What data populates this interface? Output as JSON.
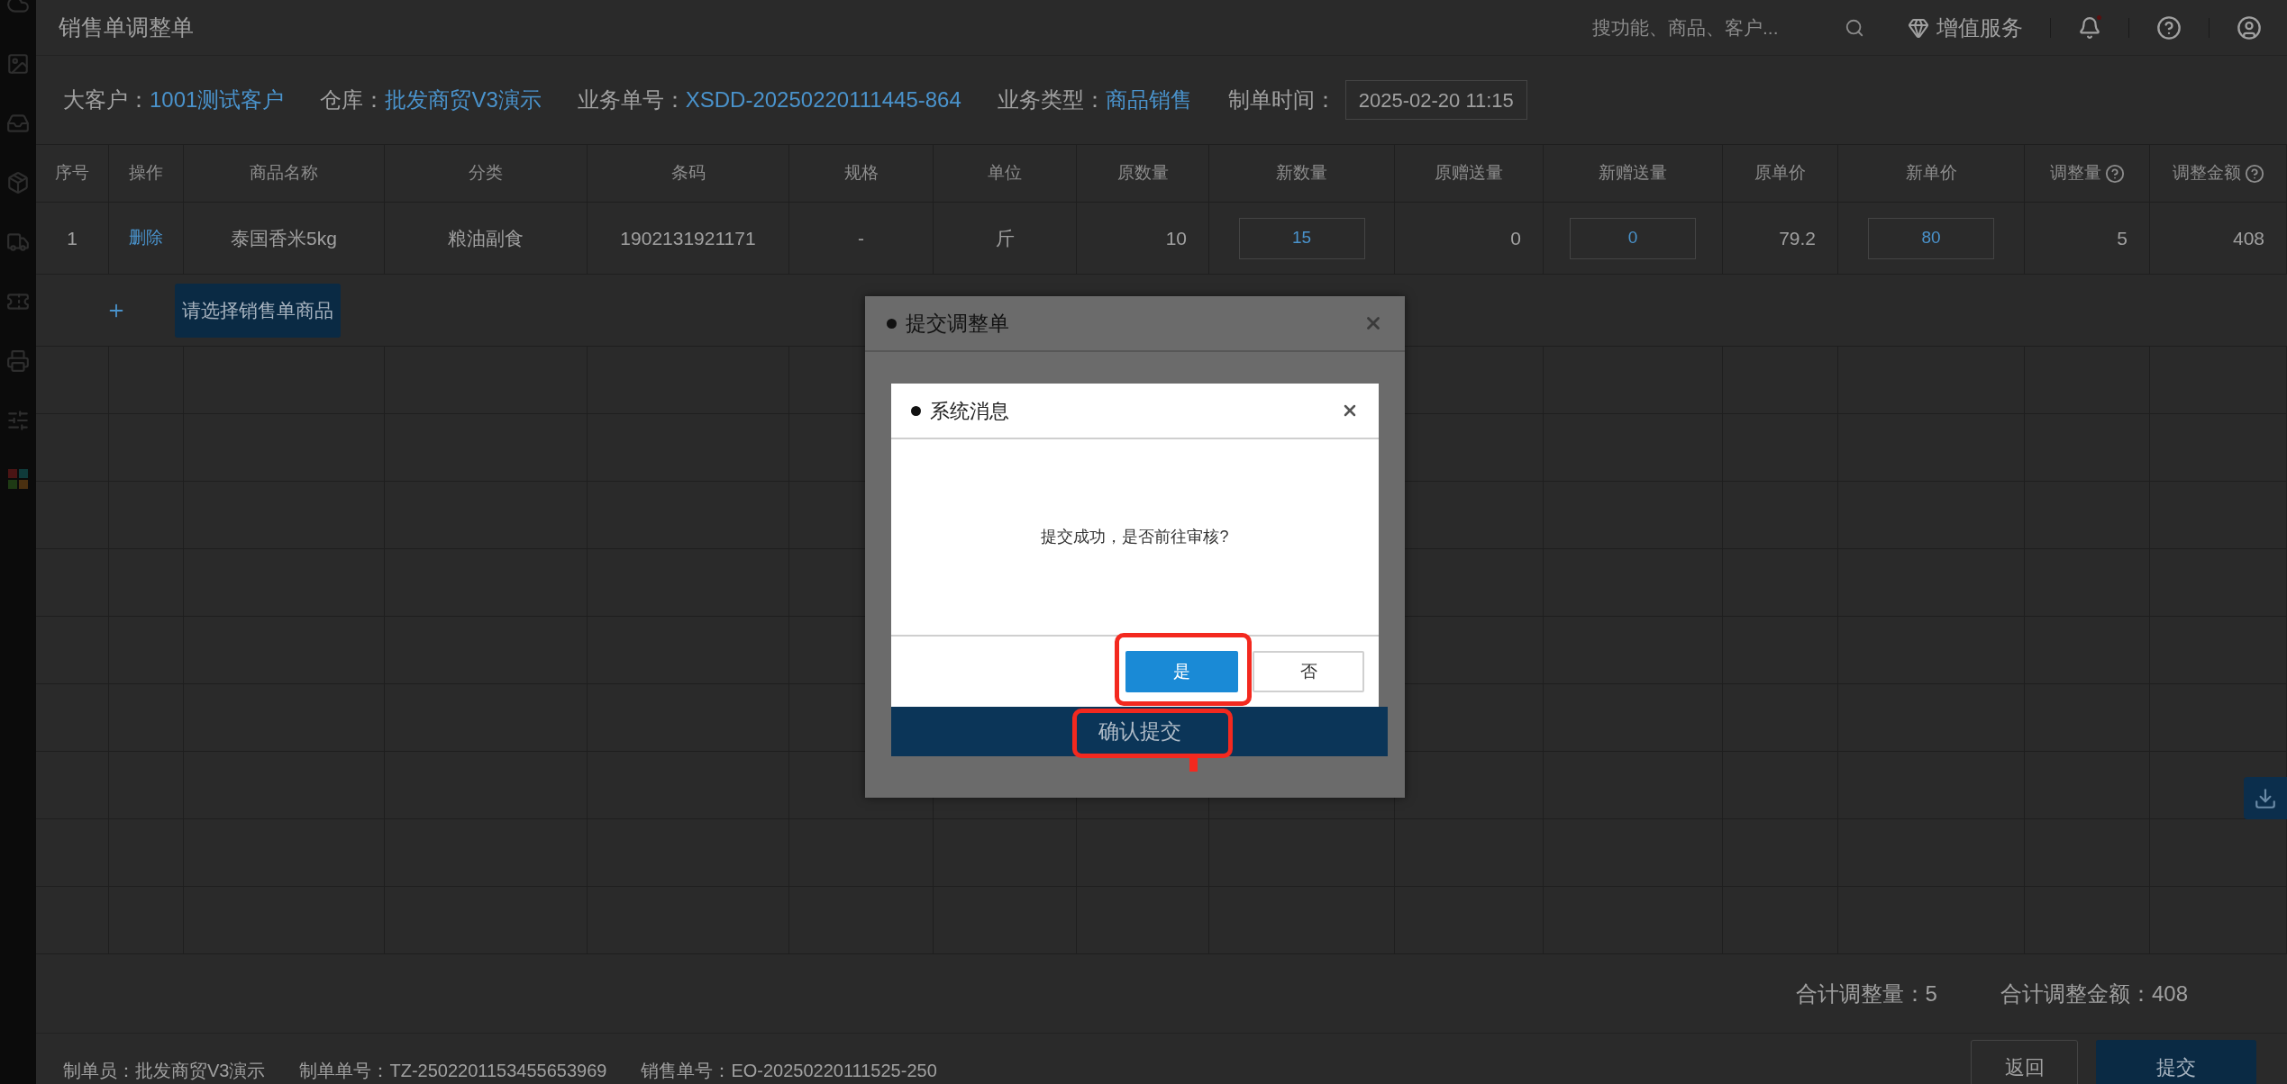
{
  "app_bar": {
    "title": "销售单调整单",
    "search": {
      "placeholder": "搜功能、商品、客户..."
    },
    "value_service": "增值服务"
  },
  "order_info": [
    {
      "label": "大客户：",
      "value": "1001测试客户"
    },
    {
      "label": "仓库：",
      "value": "批发商贸V3演示"
    },
    {
      "label": "业务单号：",
      "value": "XSDD-20250220111445-864"
    },
    {
      "label": "业务类型：",
      "value": "商品销售"
    }
  ],
  "created_time": {
    "label": "制单时间：",
    "value": "2025-02-20 11:15"
  },
  "table": {
    "columns": [
      {
        "label": "序号",
        "help_icon": false
      },
      {
        "label": "操作",
        "help_icon": false
      },
      {
        "label": "商品名称",
        "help_icon": false
      },
      {
        "label": "分类",
        "help_icon": false
      },
      {
        "label": "条码",
        "help_icon": false
      },
      {
        "label": "规格",
        "help_icon": false
      },
      {
        "label": "单位",
        "help_icon": false
      },
      {
        "label": "原数量",
        "help_icon": false
      },
      {
        "label": "新数量",
        "help_icon": false
      },
      {
        "label": "原赠送量",
        "help_icon": false
      },
      {
        "label": "新赠送量",
        "help_icon": false
      },
      {
        "label": "原单价",
        "help_icon": false
      },
      {
        "label": "新单价",
        "help_icon": false
      },
      {
        "label": "调整量",
        "help_icon": true
      },
      {
        "label": "调整金额",
        "help_icon": true
      }
    ],
    "rows": [
      [
        {
          "kind": "text",
          "text": "1"
        },
        {
          "kind": "link",
          "text": "删除"
        },
        {
          "kind": "text",
          "text": "泰国香米5kg"
        },
        {
          "kind": "text",
          "text": "粮油副食"
        },
        {
          "kind": "text",
          "text": "1902131921171"
        },
        {
          "kind": "text",
          "text": "-"
        },
        {
          "kind": "text",
          "text": "斤"
        },
        {
          "kind": "text",
          "text": "10"
        },
        {
          "kind": "input",
          "text": "15"
        },
        {
          "kind": "text",
          "text": "0"
        },
        {
          "kind": "input",
          "text": "0"
        },
        {
          "kind": "text",
          "text": "79.2"
        },
        {
          "kind": "input",
          "text": "80"
        },
        {
          "kind": "text",
          "text": "5"
        },
        {
          "kind": "text",
          "text": "408"
        }
      ]
    ],
    "add_button": "请选择销售单商品"
  },
  "totals": [
    "合计调整量：5",
    "合计调整金额：408"
  ],
  "footer": {
    "info": [
      "制单员：批发商贸V3演示",
      "制单单号：TZ-2502201153455653969",
      "销售单号：EO-20250220111525-250"
    ],
    "buttons": [
      {
        "label": "返回",
        "kind": "default"
      },
      {
        "label": "提交",
        "kind": "primary"
      }
    ]
  },
  "submit_dialog": {
    "title": "提交调整单",
    "confirm_button": "确认提交"
  },
  "message_dialog": {
    "title": "系统消息",
    "message": "提交成功，是否前往审核?",
    "buttons": [
      {
        "label": "是",
        "kind": "primary"
      },
      {
        "label": "否",
        "kind": "default"
      }
    ]
  }
}
